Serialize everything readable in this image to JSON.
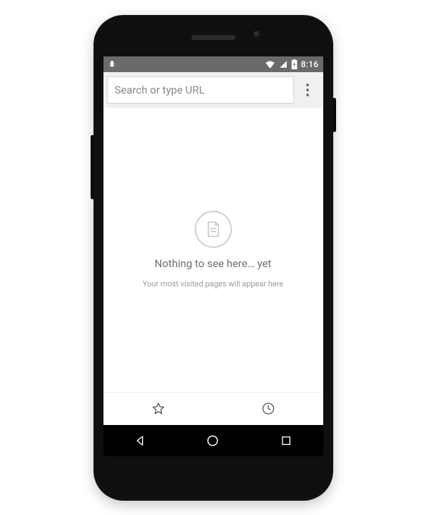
{
  "statusbar": {
    "time": "8:16"
  },
  "omnibox": {
    "placeholder": "Search or type URL"
  },
  "empty_state": {
    "title": "Nothing to see here… yet",
    "subtitle": "Your most visited pages will appear here"
  }
}
